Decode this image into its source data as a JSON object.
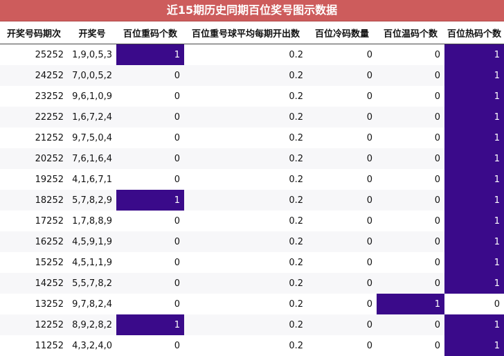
{
  "title": "近15期历史同期百位奖号图示数据",
  "highlight_color": "#3a0a8a",
  "header_color": "#cd5c5c",
  "columns": [
    "开奖号码期次",
    "开奖号",
    "百位重码个数",
    "百位重号球平均每期开出数",
    "百位冷码数量",
    "百位温码个数",
    "百位热码个数"
  ],
  "rows": [
    {
      "period": "25252",
      "numbers": "1,9,0,5,3",
      "repeat": "1",
      "avg": "0.2",
      "cold": "0",
      "warm": "0",
      "hot": "1"
    },
    {
      "period": "24252",
      "numbers": "7,0,0,5,2",
      "repeat": "0",
      "avg": "0.2",
      "cold": "0",
      "warm": "0",
      "hot": "1"
    },
    {
      "period": "23252",
      "numbers": "9,6,1,0,9",
      "repeat": "0",
      "avg": "0.2",
      "cold": "0",
      "warm": "0",
      "hot": "1"
    },
    {
      "period": "22252",
      "numbers": "1,6,7,2,4",
      "repeat": "0",
      "avg": "0.2",
      "cold": "0",
      "warm": "0",
      "hot": "1"
    },
    {
      "period": "21252",
      "numbers": "9,7,5,0,4",
      "repeat": "0",
      "avg": "0.2",
      "cold": "0",
      "warm": "0",
      "hot": "1"
    },
    {
      "period": "20252",
      "numbers": "7,6,1,6,4",
      "repeat": "0",
      "avg": "0.2",
      "cold": "0",
      "warm": "0",
      "hot": "1"
    },
    {
      "period": "19252",
      "numbers": "4,1,6,7,1",
      "repeat": "0",
      "avg": "0.2",
      "cold": "0",
      "warm": "0",
      "hot": "1"
    },
    {
      "period": "18252",
      "numbers": "5,7,8,2,9",
      "repeat": "1",
      "avg": "0.2",
      "cold": "0",
      "warm": "0",
      "hot": "1"
    },
    {
      "period": "17252",
      "numbers": "1,7,8,8,9",
      "repeat": "0",
      "avg": "0.2",
      "cold": "0",
      "warm": "0",
      "hot": "1"
    },
    {
      "period": "16252",
      "numbers": "4,5,9,1,9",
      "repeat": "0",
      "avg": "0.2",
      "cold": "0",
      "warm": "0",
      "hot": "1"
    },
    {
      "period": "15252",
      "numbers": "4,5,1,1,9",
      "repeat": "0",
      "avg": "0.2",
      "cold": "0",
      "warm": "0",
      "hot": "1"
    },
    {
      "period": "14252",
      "numbers": "5,5,7,8,2",
      "repeat": "0",
      "avg": "0.2",
      "cold": "0",
      "warm": "0",
      "hot": "1"
    },
    {
      "period": "13252",
      "numbers": "9,7,8,2,4",
      "repeat": "0",
      "avg": "0.2",
      "cold": "0",
      "warm": "1",
      "hot": "0"
    },
    {
      "period": "12252",
      "numbers": "8,9,2,8,2",
      "repeat": "1",
      "avg": "0.2",
      "cold": "0",
      "warm": "0",
      "hot": "1"
    },
    {
      "period": "11252",
      "numbers": "4,3,2,4,0",
      "repeat": "0",
      "avg": "0.2",
      "cold": "0",
      "warm": "0",
      "hot": "1"
    }
  ]
}
